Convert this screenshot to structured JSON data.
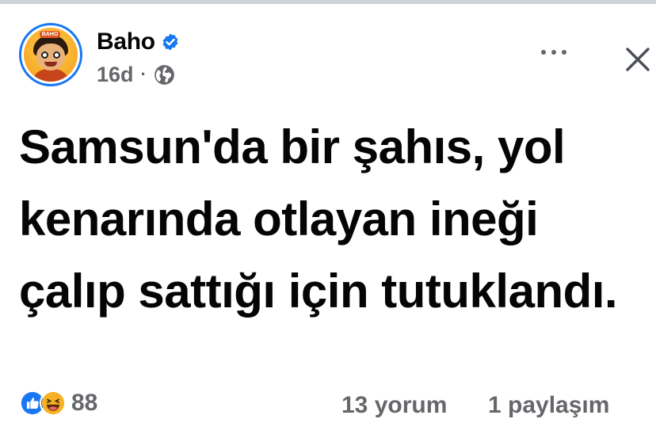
{
  "post": {
    "author": {
      "name": "Baho",
      "verified": true,
      "avatar_text": "BAHO"
    },
    "timestamp": "16d",
    "separator": "·",
    "privacy_icon": "globe-icon",
    "body_text": "Samsun'da bir şahıs, yol kenarında otlayan ineği çalıp sattığı için tutuklandı.",
    "actions": {
      "more_icon": "more-horizontal-icon",
      "close_icon": "close-icon"
    },
    "stats": {
      "reaction_types": [
        "like",
        "haha"
      ],
      "reaction_count": "88",
      "comments": "13 yorum",
      "shares": "1 paylaşım"
    }
  },
  "colors": {
    "brand_blue": "#1877f2",
    "secondary_text": "#65676b",
    "primary_text": "#050505",
    "haha_yellow": "#f7b125"
  }
}
